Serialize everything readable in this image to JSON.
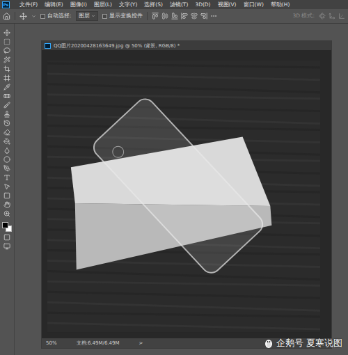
{
  "app": {
    "logo": "Ps"
  },
  "menu": [
    "文件(F)",
    "编辑(E)",
    "图像(I)",
    "图层(L)",
    "文字(Y)",
    "选择(S)",
    "滤镜(T)",
    "3D(D)",
    "视图(V)",
    "窗口(W)",
    "帮助(H)"
  ],
  "options_bar": {
    "auto_select": {
      "label": "自动选择:",
      "checked": false
    },
    "target": "图层",
    "show_transform": {
      "label": "显示变换控件",
      "checked": false
    },
    "mode_label": "3D 模式:"
  },
  "toolbox": {
    "foreground": "#000000",
    "background": "#ffffff"
  },
  "document": {
    "title": "QQ图片20200428163649.jpg @ 50% (背景, RGB/8) *",
    "zoom": "50%",
    "doc_info": "文档:6.49M/6.49M",
    "arrow": ">"
  },
  "watermark": {
    "text": "企鹅号 夏寒说图"
  }
}
